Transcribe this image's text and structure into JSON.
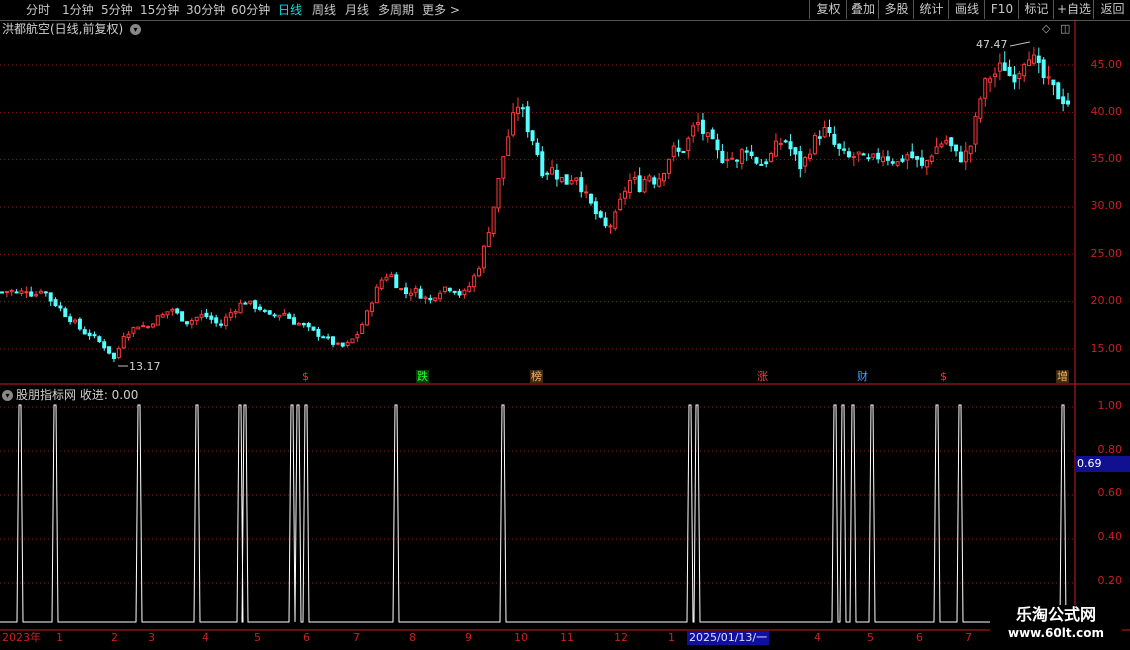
{
  "toolbar": {
    "periods": [
      "分时",
      "1分钟",
      "5分钟",
      "15分钟",
      "30分钟",
      "60分钟",
      "日线",
      "周线",
      "月线",
      "多周期",
      "更多 >"
    ],
    "active_period": "日线",
    "right_buttons": [
      "复权",
      "叠加",
      "多股",
      "统计",
      "画线",
      "F10",
      "标记",
      "+自选",
      "返回"
    ]
  },
  "main_chart": {
    "title": "洪都航空(日线,前复权)",
    "high_label": "47.47",
    "low_label": "13.17",
    "y_ticks": [
      "45.00",
      "40.00",
      "35.00",
      "30.00",
      "25.00",
      "20.00",
      "15.00"
    ],
    "events": [
      {
        "text": "$",
        "color": "#ff3030",
        "bg": "#000"
      },
      {
        "text": "跌",
        "color": "#30ff30",
        "bg": "#0a3a0a"
      },
      {
        "text": "榜",
        "color": "#ffb060",
        "bg": "#3a2a10"
      },
      {
        "text": "涨",
        "color": "#ff4040",
        "bg": "#000"
      },
      {
        "text": "财",
        "color": "#40a0ff",
        "bg": "#000"
      },
      {
        "text": "$",
        "color": "#ff3030",
        "bg": "#000"
      },
      {
        "text": "增",
        "color": "#ffb060",
        "bg": "#3a2a10"
      }
    ]
  },
  "indicator": {
    "title": "股朋指标网 收进: 0.00",
    "y_ticks": [
      "1.00",
      "0.80",
      "0.60",
      "0.40",
      "0.20"
    ],
    "current_value": "0.69"
  },
  "x_axis": {
    "labels": [
      "2023年",
      "1",
      "2",
      "3",
      "4",
      "5",
      "6",
      "7",
      "8",
      "9",
      "10",
      "11",
      "12",
      "1",
      "2025/01/13/一",
      "4",
      "5",
      "6",
      "7"
    ]
  },
  "watermark": {
    "line1": "乐淘公式网",
    "line2": "www.60lt.com"
  },
  "colors": {
    "up": "#ff3a3a",
    "down": "#54ffff",
    "axis": "#c82020",
    "grid": "#8a1a1a"
  },
  "chart_data": {
    "type": "candlestick",
    "y_range": [
      13.17,
      47.47
    ],
    "y_ticks": [
      15,
      20,
      25,
      30,
      35,
      40,
      45
    ],
    "close_path": [
      21.0,
      21.2,
      20.8,
      21.3,
      20.6,
      21.5,
      20.2,
      19.5,
      18.5,
      17.8,
      16.8,
      16.5,
      15.8,
      15.0,
      13.8,
      16.5,
      17.0,
      17.6,
      17.3,
      18.2,
      18.6,
      19.3,
      18.4,
      17.8,
      18.3,
      18.6,
      18.1,
      17.4,
      18.6,
      19.3,
      20.1,
      19.6,
      19.3,
      18.4,
      18.6,
      18.8,
      17.9,
      17.6,
      17.1,
      16.6,
      16.3,
      15.6,
      15.2,
      15.6,
      16.6,
      18.3,
      20.6,
      22.3,
      23.1,
      21.6,
      20.9,
      21.3,
      20.6,
      20.1,
      21.1,
      21.6,
      21.3,
      20.6,
      21.8,
      23.6,
      26.6,
      30.6,
      35.1,
      38.6,
      41.1,
      38.6,
      36.6,
      33.6,
      34.1,
      33.1,
      32.6,
      33.6,
      31.6,
      30.1,
      28.6,
      27.6,
      29.1,
      31.6,
      33.1,
      32.1,
      33.6,
      32.6,
      34.1,
      36.1,
      35.6,
      37.1,
      39.1,
      37.6,
      36.6,
      35.1,
      35.6,
      34.6,
      36.6,
      35.1,
      34.6,
      35.1,
      36.6,
      37.1,
      35.6,
      34.1,
      36.1,
      37.6,
      38.1,
      36.6,
      35.6,
      35.1,
      35.6,
      34.6,
      35.1,
      35.6,
      35.1,
      34.6,
      35.6,
      35.1,
      34.1,
      35.6,
      36.6,
      37.1,
      35.6,
      35.1,
      36.6,
      41.1,
      43.6,
      44.1,
      45.1,
      43.6,
      44.6,
      46.6,
      45.1,
      43.6,
      42.6,
      41.6,
      41.1
    ],
    "indicator_spikes_x": [
      20,
      55,
      139,
      197,
      240,
      245,
      292,
      298,
      306,
      396,
      503,
      690,
      697,
      835,
      843,
      853,
      872,
      937,
      960,
      1063
    ]
  }
}
